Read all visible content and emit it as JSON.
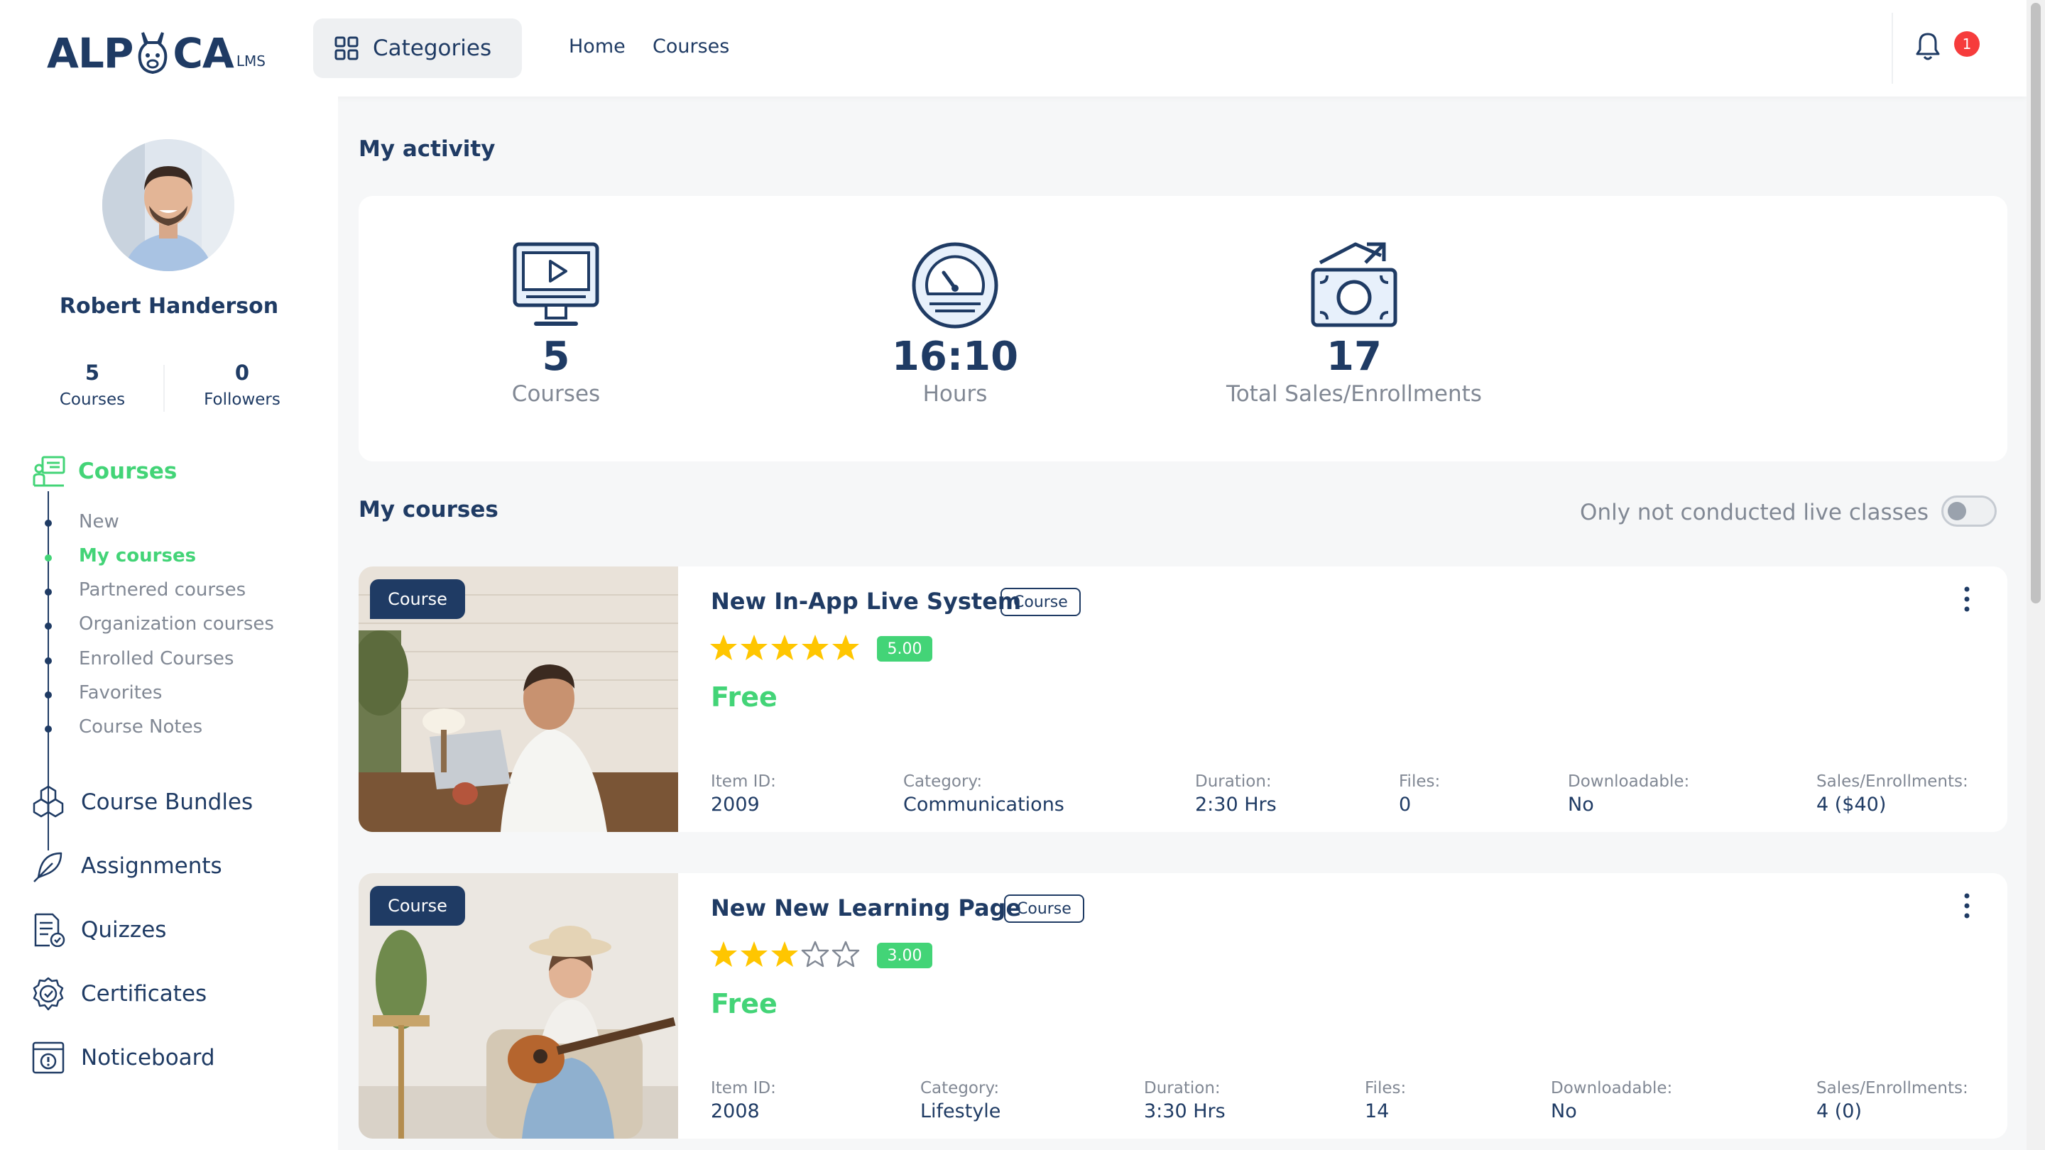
{
  "header": {
    "logo_main_left": "ALP",
    "logo_main_right": "CA",
    "logo_sub": "LMS",
    "categories_label": "Categories",
    "nav": [
      "Home",
      "Courses"
    ],
    "notification_count": "1"
  },
  "sidebar": {
    "user_name": "Robert Handerson",
    "stats": [
      {
        "value": "5",
        "label": "Courses"
      },
      {
        "value": "0",
        "label": "Followers"
      }
    ],
    "courses_label": "Courses",
    "submenu": [
      {
        "label": "New",
        "active": false
      },
      {
        "label": "My courses",
        "active": true
      },
      {
        "label": "Partnered courses",
        "active": false
      },
      {
        "label": "Organization courses",
        "active": false
      },
      {
        "label": "Enrolled Courses",
        "active": false
      },
      {
        "label": "Favorites",
        "active": false
      },
      {
        "label": "Course Notes",
        "active": false
      }
    ],
    "menu": [
      {
        "label": "Course Bundles",
        "icon": "cubes-icon"
      },
      {
        "label": "Assignments",
        "icon": "feather-pen-icon"
      },
      {
        "label": "Quizzes",
        "icon": "quiz-sheet-icon"
      },
      {
        "label": "Certificates",
        "icon": "certificate-badge-icon"
      },
      {
        "label": "Noticeboard",
        "icon": "noticeboard-icon"
      }
    ]
  },
  "activity": {
    "title": "My activity",
    "items": [
      {
        "value": "5",
        "label": "Courses",
        "icon": "monitor-icon"
      },
      {
        "value": "16:10",
        "label": "Hours",
        "icon": "speedometer-icon"
      },
      {
        "value": "17",
        "label": "Total Sales/Enrollments",
        "icon": "money-icon"
      }
    ]
  },
  "my_courses": {
    "title": "My courses",
    "toggle_label": "Only not conducted live classes",
    "toggle_on": false,
    "courses": [
      {
        "badge": "Course",
        "title": "New In-App Live System",
        "type": "Course",
        "rating": 5,
        "rating_label": "5.00",
        "price": "Free",
        "meta": [
          {
            "label": "Item ID:",
            "value": "2009"
          },
          {
            "label": "Category:",
            "value": "Communications"
          },
          {
            "label": "Duration:",
            "value": "2:30 Hrs"
          },
          {
            "label": "Files:",
            "value": "0"
          },
          {
            "label": "Downloadable:",
            "value": "No"
          },
          {
            "label": "Sales/Enrollments:",
            "value": "4 ($40)"
          }
        ]
      },
      {
        "badge": "Course",
        "title": "New New Learning Page",
        "type": "Course",
        "rating": 3,
        "rating_label": "3.00",
        "price": "Free",
        "meta": [
          {
            "label": "Item ID:",
            "value": "2008"
          },
          {
            "label": "Category:",
            "value": "Lifestyle"
          },
          {
            "label": "Duration:",
            "value": "3:30 Hrs"
          },
          {
            "label": "Files:",
            "value": "14"
          },
          {
            "label": "Downloadable:",
            "value": "No"
          },
          {
            "label": "Sales/Enrollments:",
            "value": "4 (0)"
          }
        ]
      }
    ]
  },
  "colors": {
    "primary": "#1f3b64",
    "accent": "#43d477",
    "muted": "#818894",
    "star": "#ffc600",
    "danger": "#f63c3c"
  }
}
